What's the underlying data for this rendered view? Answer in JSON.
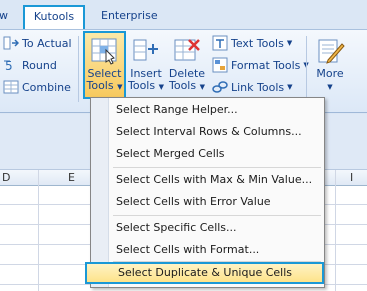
{
  "tabs": {
    "prev": "w",
    "kutools": "Kutools",
    "enterprise": "Enterprise"
  },
  "ribbon": {
    "left_items": [
      "To Actual",
      "Round",
      "Combine"
    ],
    "select_tools": {
      "line1": "Select",
      "line2": "Tools"
    },
    "insert_tools": {
      "line1": "Insert",
      "line2": "Tools"
    },
    "delete_tools": {
      "line1": "Delete",
      "line2": "Tools"
    },
    "right_items": [
      "Text Tools",
      "Format Tools",
      "Link Tools"
    ],
    "more": "More"
  },
  "sheet": {
    "columns": [
      "D",
      "E",
      "I"
    ]
  },
  "menu": {
    "items": [
      "Select Range Helper...",
      "Select Interval Rows & Columns...",
      "Select Merged Cells",
      "Select Cells with Max & Min Value...",
      "Select Cells with Error Value",
      "Select Specific Cells...",
      "Select Cells with Format...",
      "Select Duplicate & Unique Cells"
    ]
  },
  "colors": {
    "accent": "#1a98d6",
    "highlight": "#fde38a",
    "ribbon_text": "#15428b"
  },
  "icons": [
    "to-actual-icon",
    "round-icon",
    "combine-icon",
    "select-tools-icon",
    "insert-tools-icon",
    "delete-tools-icon",
    "text-tools-icon",
    "format-tools-icon",
    "link-tools-icon",
    "more-icon"
  ]
}
